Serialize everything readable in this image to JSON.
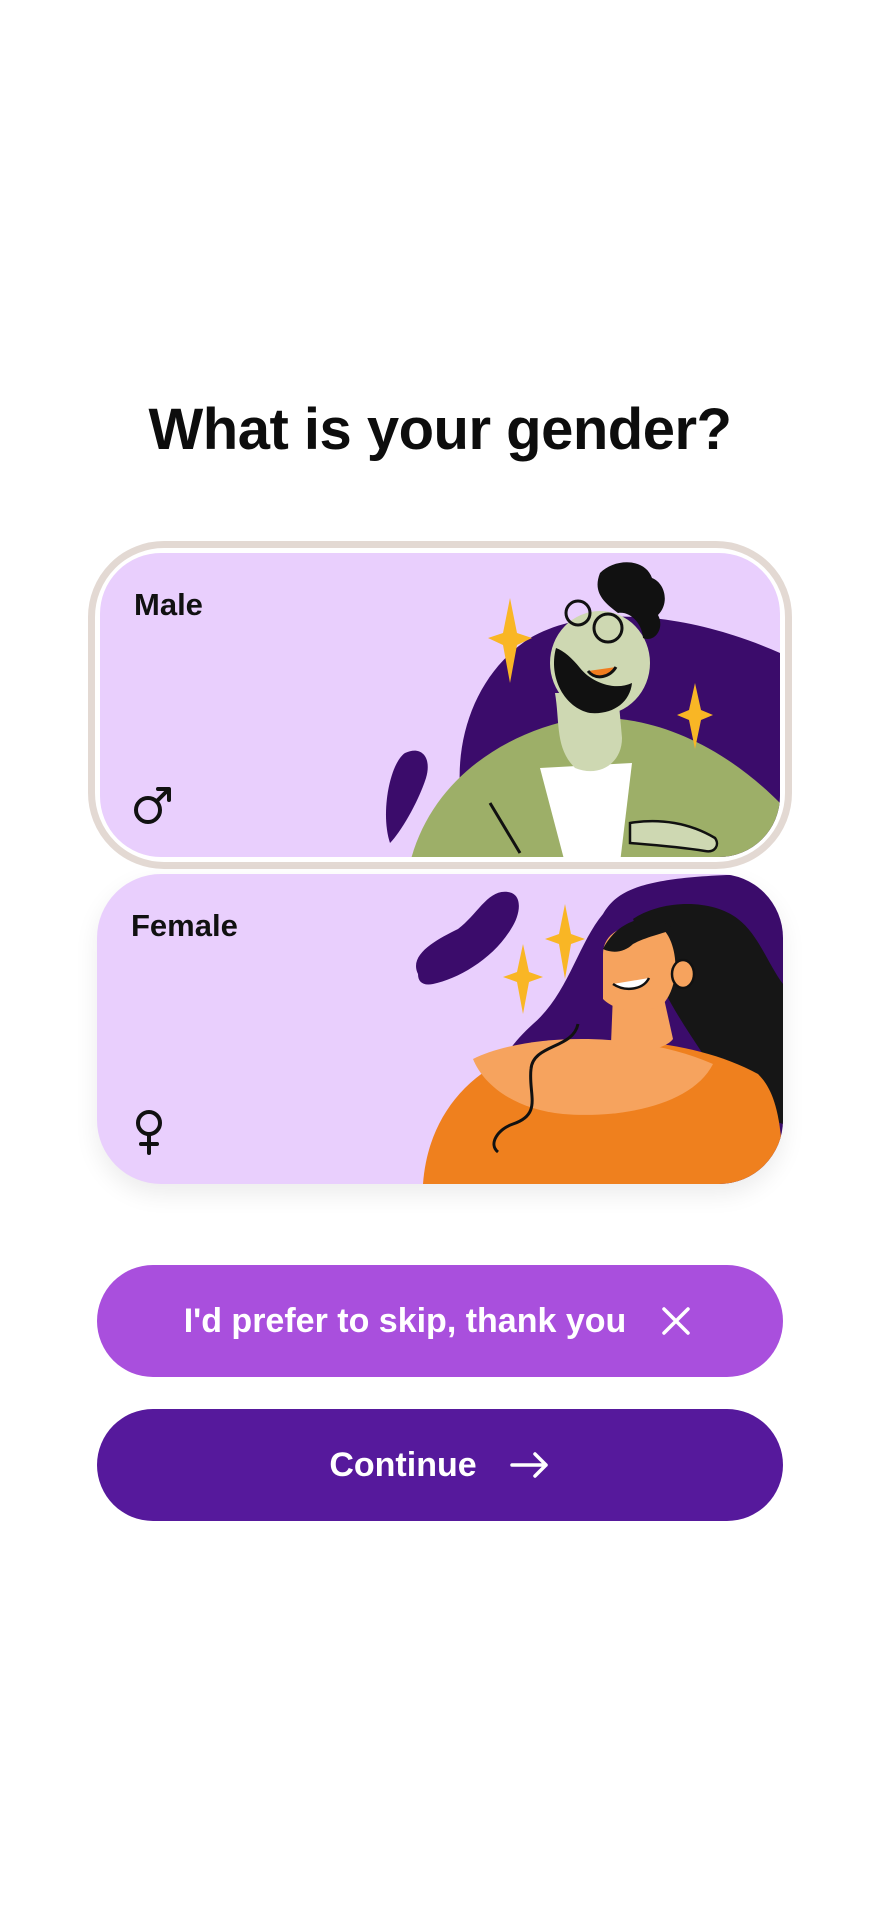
{
  "title": "What is your gender?",
  "options": [
    {
      "label": "Male",
      "symbol": "male-symbol-icon",
      "selected": true
    },
    {
      "label": "Female",
      "symbol": "female-symbol-icon",
      "selected": false
    }
  ],
  "buttons": {
    "skip_label": "I'd prefer to skip, thank you",
    "continue_label": "Continue"
  },
  "colors": {
    "card_bg": "#e9cffd",
    "illustration_dark": "#3b0c6b",
    "skip_button": "#a94fdd",
    "continue_button": "#56199c",
    "selected_border": "#e3d9d3",
    "sparkle": "#f9b625"
  }
}
